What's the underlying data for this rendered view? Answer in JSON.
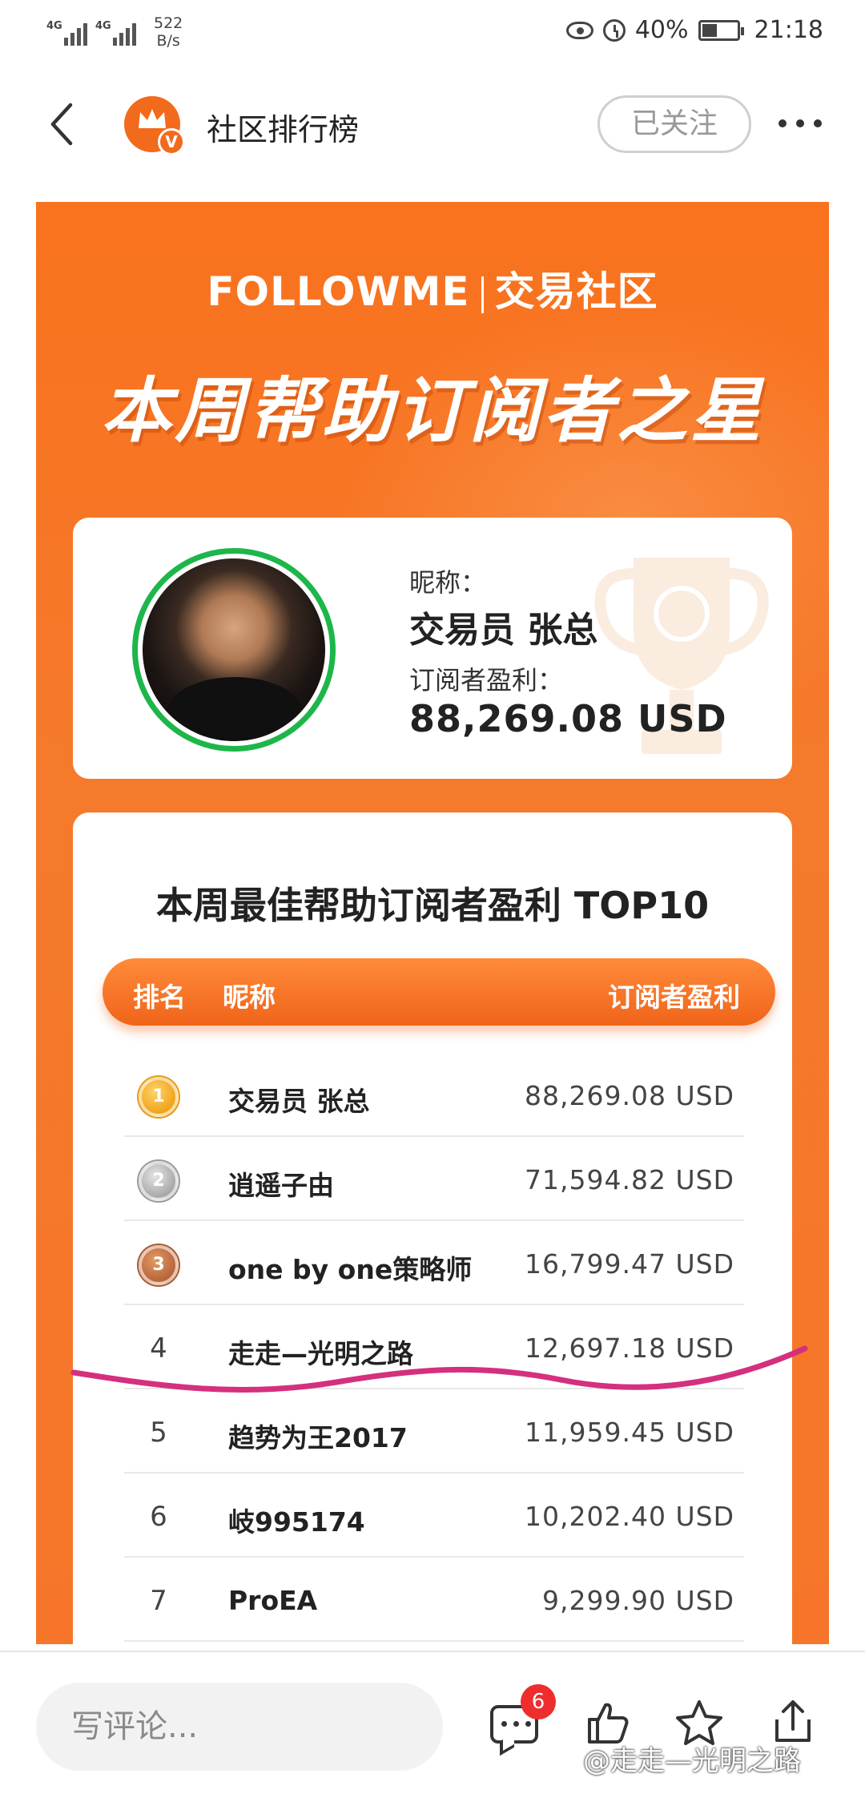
{
  "status_bar": {
    "net1": "4G",
    "net2": "4G",
    "speed_value": "522",
    "speed_unit": "B/s",
    "battery": "40%",
    "time": "21:18"
  },
  "header": {
    "title": "社区排行榜",
    "follow_label": "已关注",
    "logo_badge": "V"
  },
  "banner": {
    "brand": "FOLLOWME",
    "brand_suffix": "交易社区",
    "title": "本周帮助订阅者之星"
  },
  "winner": {
    "nickname_label": "昵称：",
    "nickname": "交易员 张总",
    "profit_label": "订阅者盈利：",
    "profit": "88,269.08 USD"
  },
  "ranking": {
    "title": "本周最佳帮助订阅者盈利 TOP10",
    "col_rank": "排名",
    "col_name": "昵称",
    "col_profit": "订阅者盈利",
    "rows": [
      {
        "rank": "1",
        "name": "交易员 张总",
        "profit": "88,269.08 USD",
        "medal": "gold"
      },
      {
        "rank": "2",
        "name": "逍遥子由",
        "profit": "71,594.82 USD",
        "medal": "silver"
      },
      {
        "rank": "3",
        "name": "one by one策略师",
        "profit": "16,799.47 USD",
        "medal": "bronze"
      },
      {
        "rank": "4",
        "name": "走走—光明之路",
        "profit": "12,697.18 USD"
      },
      {
        "rank": "5",
        "name": "趋势为王2017",
        "profit": "11,959.45 USD"
      },
      {
        "rank": "6",
        "name": "岐995174",
        "profit": "10,202.40 USD"
      },
      {
        "rank": "7",
        "name": "ProEA",
        "profit": "9,299.90 USD"
      }
    ]
  },
  "bottom_bar": {
    "comment_placeholder": "写评论...",
    "comment_count": "6",
    "watermark": "@走走—光明之路"
  },
  "colors": {
    "brand_orange": "#f9721e",
    "winner_ring": "#1db64a",
    "annotation_line": "#d4307e",
    "badge_red": "#ef2d2d"
  }
}
